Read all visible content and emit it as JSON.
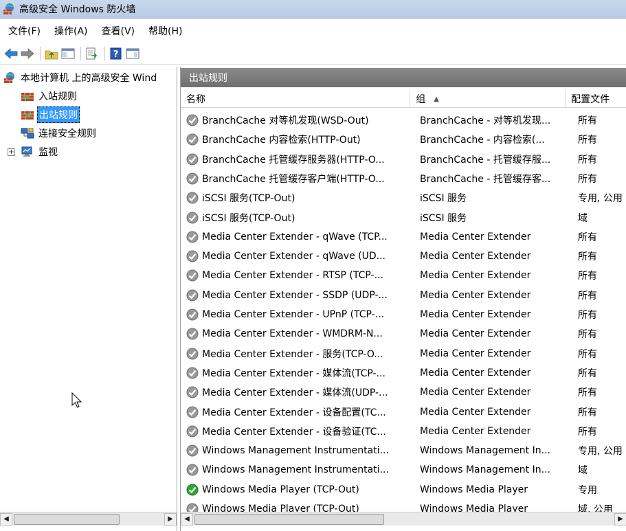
{
  "window": {
    "title": "高级安全 Windows 防火墙"
  },
  "menu": [
    {
      "label": "文件(F)"
    },
    {
      "label": "操作(A)"
    },
    {
      "label": "查看(V)"
    },
    {
      "label": "帮助(H)"
    }
  ],
  "tree": {
    "root": "本地计算机 上的高级安全 Wind",
    "inbound": "入站规则",
    "outbound": "出站规则",
    "connection": "连接安全规则",
    "monitor": "监视",
    "expander": "+"
  },
  "main": {
    "header": "出站规则",
    "columns": {
      "name": "名称",
      "group": "组",
      "profile": "配置文件"
    },
    "sort_indicator": "▲",
    "rows": [
      {
        "name": "BranchCache 对等机发现(WSD-Out)",
        "group": "BranchCache - 对等机发现...",
        "profile": "所有",
        "enabled": false
      },
      {
        "name": "BranchCache 内容检索(HTTP-Out)",
        "group": "BranchCache - 内容检索(...",
        "profile": "所有",
        "enabled": false
      },
      {
        "name": "BranchCache 托管缓存服务器(HTTP-O...",
        "group": "BranchCache - 托管缓存服...",
        "profile": "所有",
        "enabled": false
      },
      {
        "name": "BranchCache 托管缓存客户端(HTTP-O...",
        "group": "BranchCache - 托管缓存客...",
        "profile": "所有",
        "enabled": false
      },
      {
        "name": "iSCSI 服务(TCP-Out)",
        "group": "iSCSI 服务",
        "profile": "专用, 公用",
        "enabled": false
      },
      {
        "name": "iSCSI 服务(TCP-Out)",
        "group": "iSCSI 服务",
        "profile": "域",
        "enabled": false
      },
      {
        "name": "Media Center Extender - qWave (TCP...",
        "group": "Media Center Extender",
        "profile": "所有",
        "enabled": false
      },
      {
        "name": "Media Center Extender - qWave (UD...",
        "group": "Media Center Extender",
        "profile": "所有",
        "enabled": false
      },
      {
        "name": "Media Center Extender - RTSP (TCP-...",
        "group": "Media Center Extender",
        "profile": "所有",
        "enabled": false
      },
      {
        "name": "Media Center Extender - SSDP (UDP-...",
        "group": "Media Center Extender",
        "profile": "所有",
        "enabled": false
      },
      {
        "name": "Media Center Extender - UPnP (TCP-...",
        "group": "Media Center Extender",
        "profile": "所有",
        "enabled": false
      },
      {
        "name": "Media Center Extender - WMDRM-N...",
        "group": "Media Center Extender",
        "profile": "所有",
        "enabled": false
      },
      {
        "name": "Media Center Extender - 服务(TCP-O...",
        "group": "Media Center Extender",
        "profile": "所有",
        "enabled": false
      },
      {
        "name": "Media Center Extender - 媒体流(TCP-...",
        "group": "Media Center Extender",
        "profile": "所有",
        "enabled": false
      },
      {
        "name": "Media Center Extender - 媒体流(UDP-...",
        "group": "Media Center Extender",
        "profile": "所有",
        "enabled": false
      },
      {
        "name": "Media Center Extender - 设备配置(TC...",
        "group": "Media Center Extender",
        "profile": "所有",
        "enabled": false
      },
      {
        "name": "Media Center Extender - 设备验证(TC...",
        "group": "Media Center Extender",
        "profile": "所有",
        "enabled": false
      },
      {
        "name": "Windows Management Instrumentati...",
        "group": "Windows Management In...",
        "profile": "专用, 公用",
        "enabled": false
      },
      {
        "name": "Windows Management Instrumentati...",
        "group": "Windows Management In...",
        "profile": "域",
        "enabled": false
      },
      {
        "name": "Windows Media Player (TCP-Out)",
        "group": "Windows Media Player",
        "profile": "专用",
        "enabled": true
      },
      {
        "name": "Windows Media Player (TCP-Out)",
        "group": "Windows Media Player",
        "profile": "域, 公用",
        "enabled": false
      }
    ]
  },
  "scroll": {
    "left": "◀",
    "right": "▶"
  },
  "colors": {
    "title_bar": "#c9d9ec",
    "pane_header": "#7a7a7a",
    "selection": "#3399ff",
    "enabled_rule": "#2fa52f",
    "disabled_rule": "#9a9a9a"
  }
}
